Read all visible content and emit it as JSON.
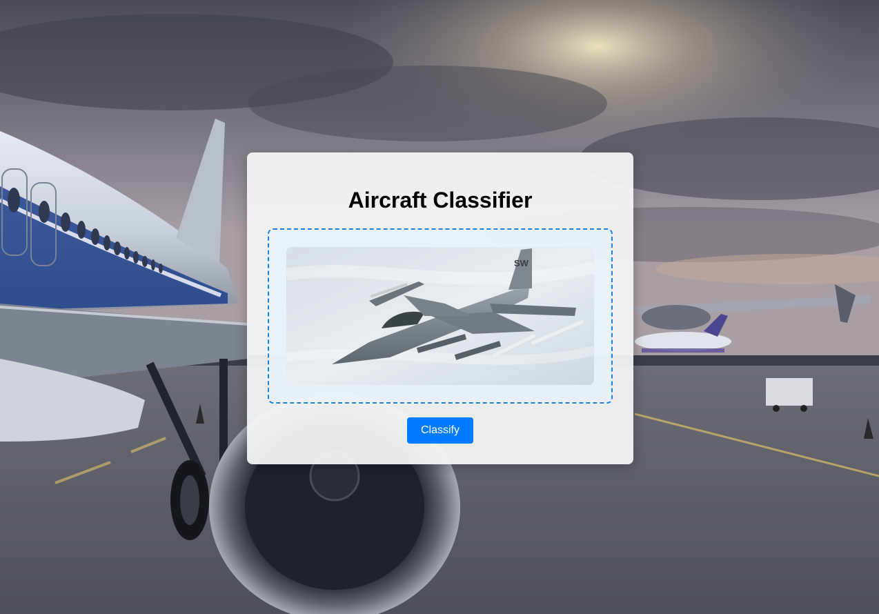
{
  "page": {
    "title": "Aircraft Classifier"
  },
  "upload": {
    "preview_subject": "fighter jet photo"
  },
  "actions": {
    "classify_label": "Classify"
  },
  "colors": {
    "accent": "#007bff",
    "dropzone_border": "#1a7fe0",
    "card_background": "#f5f6f8"
  },
  "icons": {
    "background": "airport-tarmac-image",
    "preview": "fighter-jet-image"
  }
}
